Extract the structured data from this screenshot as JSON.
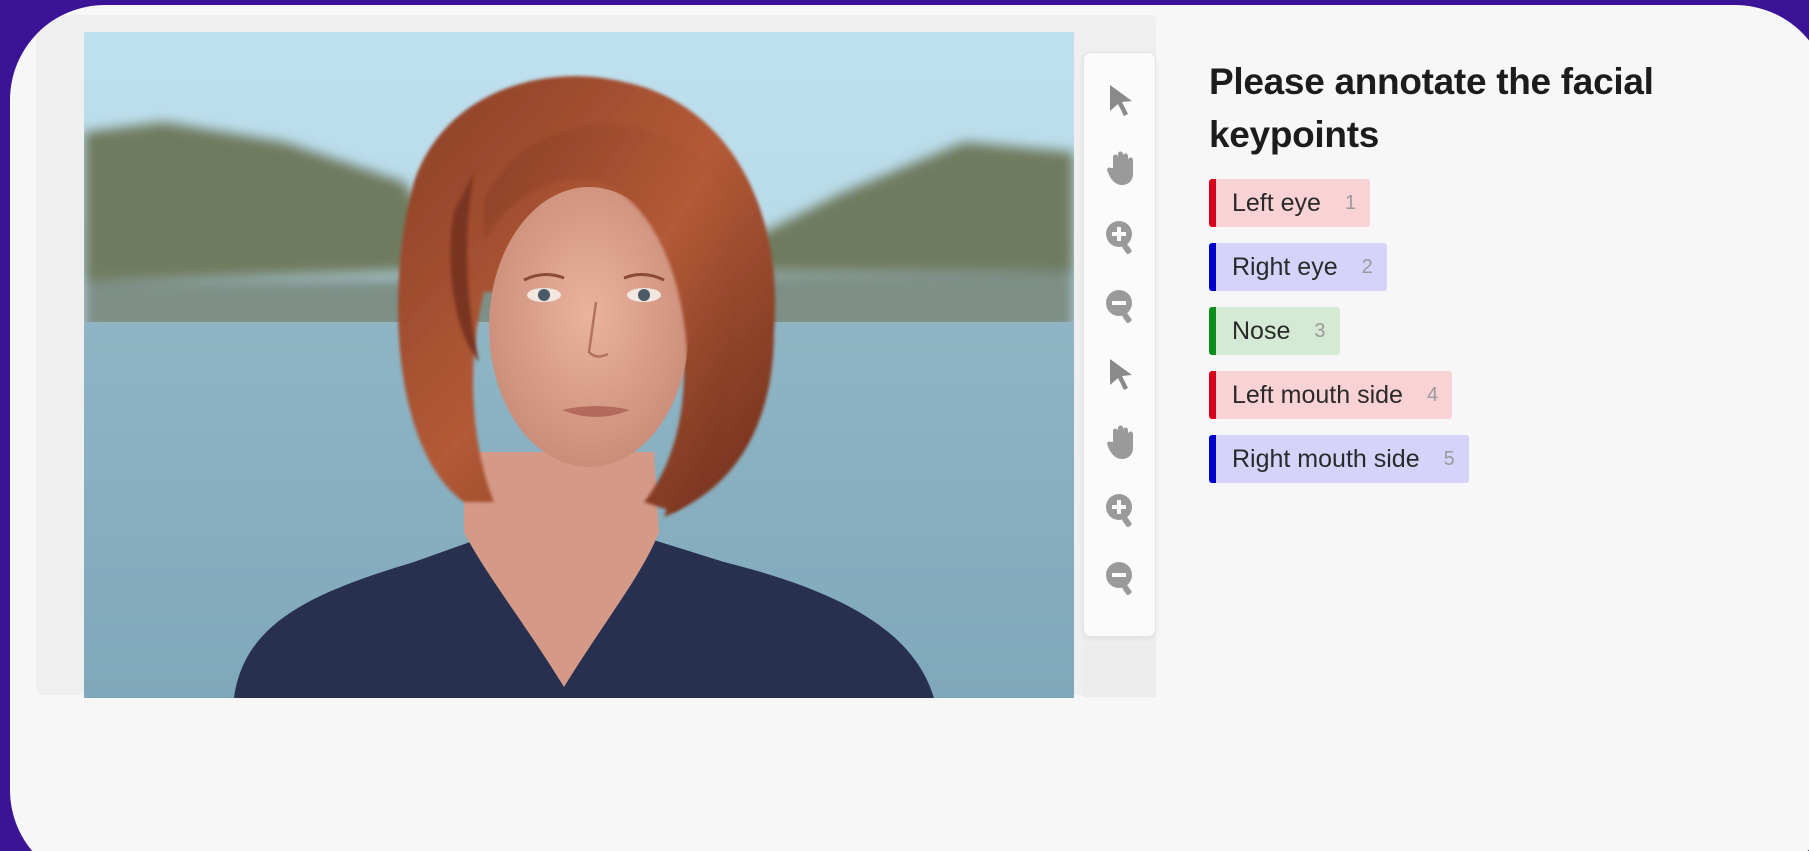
{
  "task": {
    "title": "Please annotate the facial keypoints"
  },
  "toolbar": {
    "tools": [
      {
        "name": "select-icon"
      },
      {
        "name": "pan-hand-icon"
      },
      {
        "name": "zoom-in-icon"
      },
      {
        "name": "zoom-out-icon"
      },
      {
        "name": "select-icon"
      },
      {
        "name": "pan-hand-icon"
      },
      {
        "name": "zoom-in-icon"
      },
      {
        "name": "zoom-out-icon"
      }
    ]
  },
  "labels": [
    {
      "text": "Left eye",
      "hotkey": "1",
      "color": "#d8001c",
      "bg": "#f9d2d6"
    },
    {
      "text": "Right eye",
      "hotkey": "2",
      "color": "#0000cc",
      "bg": "#d6d3fb"
    },
    {
      "text": "Nose",
      "hotkey": "3",
      "color": "#0b8f1a",
      "bg": "#d4ead4"
    },
    {
      "text": "Left mouth side",
      "hotkey": "4",
      "color": "#d8001c",
      "bg": "#f9d2d6"
    },
    {
      "text": "Right mouth side",
      "hotkey": "5",
      "color": "#0000cc",
      "bg": "#d6d3fb"
    }
  ],
  "colors": {
    "outer_background": "#3a1396",
    "panel_background": "#f7f7f7",
    "tool_icon": "#8a8a8a"
  }
}
